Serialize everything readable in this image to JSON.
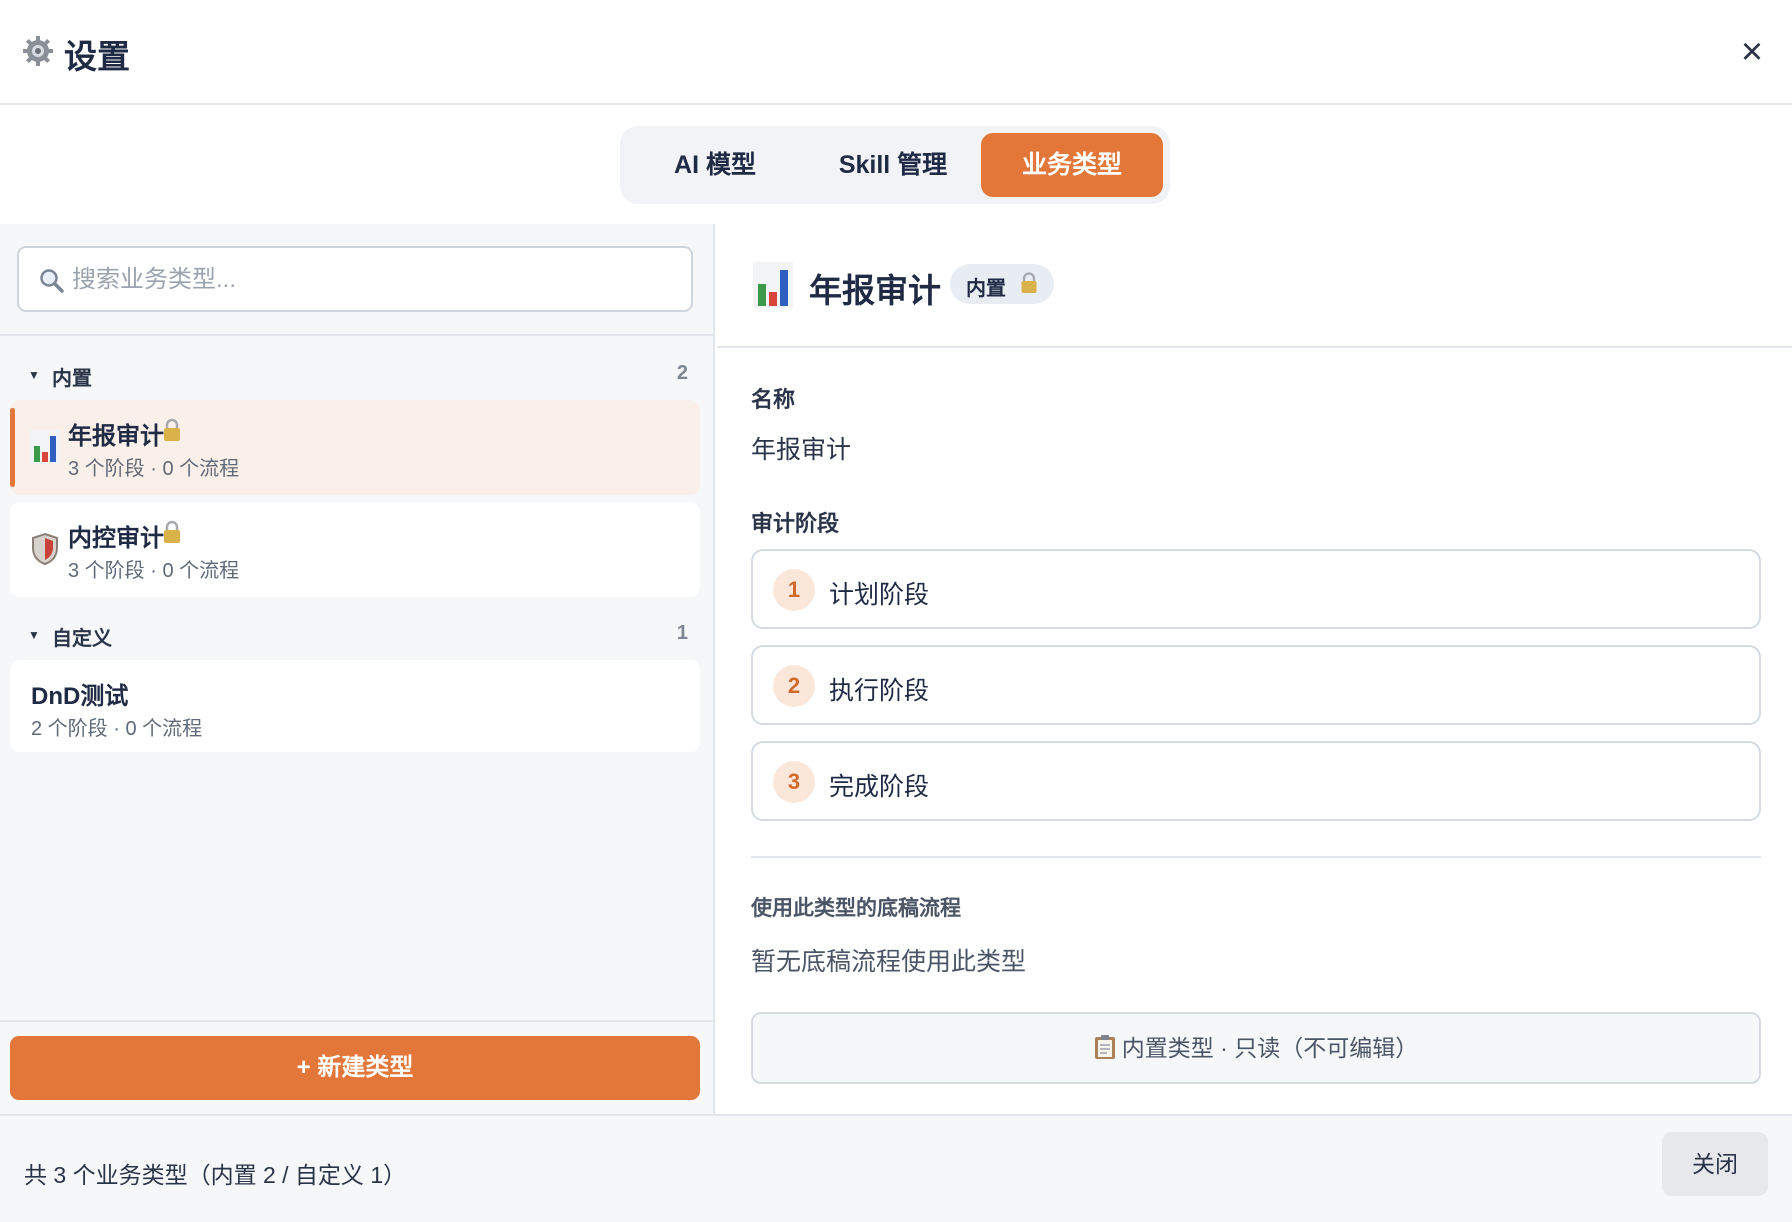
{
  "header": {
    "icon": "gear-icon",
    "title": "设置",
    "close_icon": "close-icon"
  },
  "tabs": [
    {
      "label": "AI 模型",
      "active": false
    },
    {
      "label": "Skill 管理",
      "active": false
    },
    {
      "label": "业务类型",
      "active": true
    }
  ],
  "sidebar": {
    "search_placeholder": "搜索业务类型...",
    "groups": [
      {
        "name": "内置",
        "count": "2",
        "items": [
          {
            "icon": "bar-chart-icon",
            "name": "年报审计",
            "locked": true,
            "meta": "3 个阶段 · 0 个流程",
            "active": true
          },
          {
            "icon": "shield-icon",
            "name": "内控审计",
            "locked": true,
            "meta": "3 个阶段 · 0 个流程",
            "active": false
          }
        ]
      },
      {
        "name": "自定义",
        "count": "1",
        "items": [
          {
            "name": "DnD测试",
            "locked": false,
            "meta": "2 个阶段 · 0 个流程",
            "active": false
          }
        ]
      }
    ],
    "new_button": "+ 新建类型"
  },
  "detail": {
    "icon": "bar-chart-icon",
    "title": "年报审计",
    "badge": "内置",
    "name_label": "名称",
    "name_value": "年报审计",
    "stages_label": "审计阶段",
    "stages": [
      {
        "num": "1",
        "name": "计划阶段"
      },
      {
        "num": "2",
        "name": "执行阶段"
      },
      {
        "num": "3",
        "name": "完成阶段"
      }
    ],
    "flows_label": "使用此类型的底稿流程",
    "flows_empty": "暂无底稿流程使用此类型",
    "readonly_note": "内置类型 · 只读（不可编辑）"
  },
  "footer": {
    "summary": "共 3 个业务类型（内置 2 / 自定义 1）",
    "close_button": "关闭"
  },
  "colors": {
    "accent": "#e3773a",
    "text": "#1f2a44",
    "active_bg": "#fbefe9"
  }
}
